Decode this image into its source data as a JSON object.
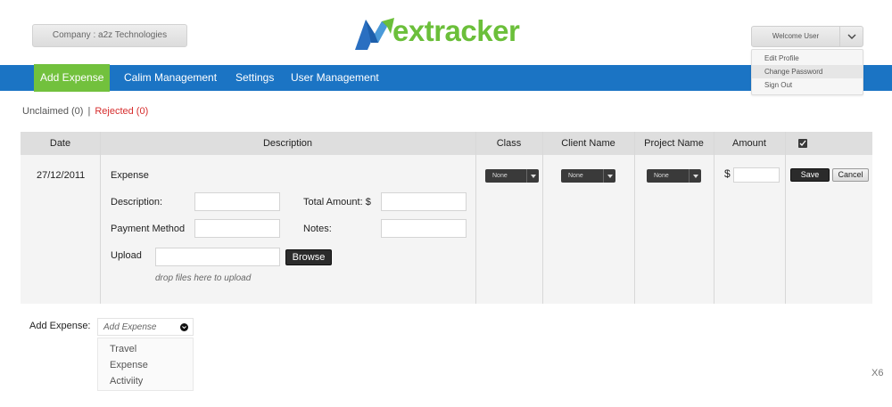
{
  "header": {
    "company_label": "Company : a2z Technologies",
    "logo_text": "extracker",
    "user": {
      "welcome": "Welcome User",
      "menu": [
        "Edit Profile",
        "Change Password",
        "Sign Out"
      ]
    }
  },
  "nav": {
    "items": [
      "Add Expense",
      "Calim Management",
      "Settings",
      "User Management"
    ],
    "active_index": 0
  },
  "filters": {
    "unclaimed": "Unclaimed (0)",
    "separator": "|",
    "rejected": "Rejected (0)"
  },
  "table": {
    "headers": {
      "date": "Date",
      "description": "Description",
      "class": "Class",
      "client_name": "Client Name",
      "project_name": "Project Name",
      "amount": "Amount"
    },
    "row": {
      "date": "27/12/2011",
      "type": "Expense",
      "description_label": "Description:",
      "total_amount_label": "Total Amount:",
      "currency": "$",
      "payment_method_label": "Payment Method",
      "notes_label": "Notes:",
      "upload_label": "Upload",
      "browse_label": "Browse",
      "drop_hint": "drop files here to upload",
      "class_value": "None",
      "client_value": "None",
      "project_value": "None",
      "amount_currency": "$",
      "save_label": "Save",
      "cancel_label": "Cancel"
    }
  },
  "add_expense": {
    "label": "Add Expense:",
    "placeholder": "Add Expense",
    "options": [
      "Travel",
      "Expense",
      "Activiity"
    ]
  },
  "corner_label": "X6",
  "colors": {
    "nav_blue": "#1b74c4",
    "active_green": "#72c13d",
    "logo_green": "#6bbf3a",
    "rejected_red": "#d62d2d"
  }
}
